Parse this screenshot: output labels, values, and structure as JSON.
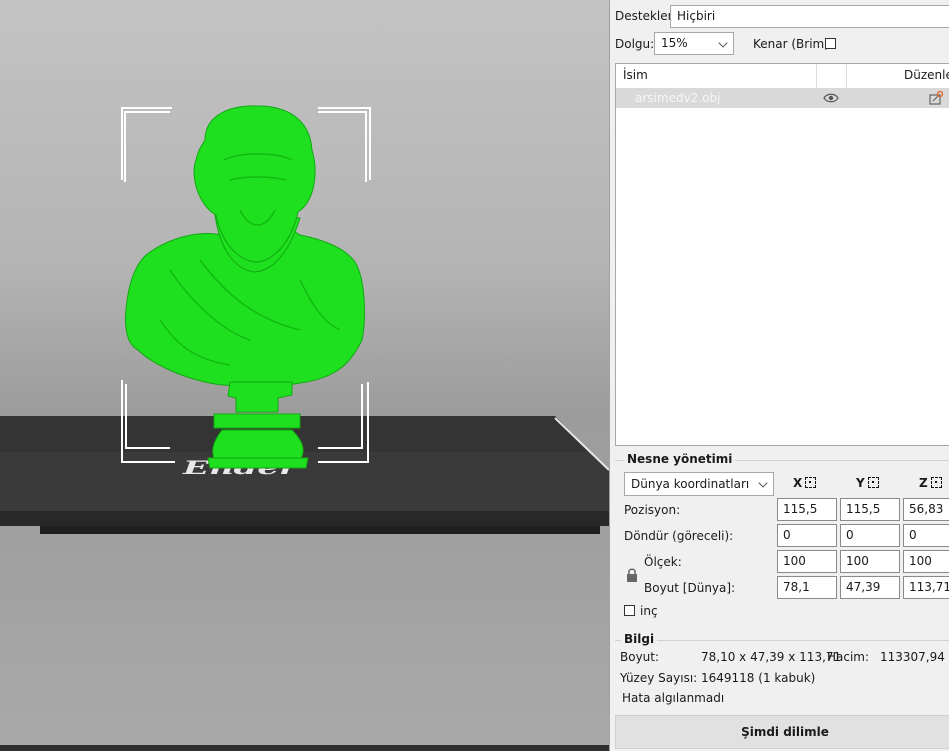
{
  "supports": {
    "label": "Destekler:",
    "value": "Hiçbiri"
  },
  "infill": {
    "label": "Dolgu:",
    "value": "15%"
  },
  "brim": {
    "label": "Kenar (Brim):",
    "checked": false
  },
  "object_list": {
    "columns": [
      "İsim",
      "",
      "Düzenler"
    ],
    "rows": [
      {
        "name": "arsimedv2.obj",
        "visible_icon": "eye-icon",
        "edit_icon": "edit-warning-icon"
      }
    ]
  },
  "object_manipulation": {
    "title": "Nesne yönetimi",
    "coordinate_system": "Dünya koordinatları",
    "axes": [
      "X",
      "Y",
      "Z"
    ],
    "position": {
      "label": "Pozisyon:",
      "values": [
        "115,5",
        "115,5",
        "56,83"
      ]
    },
    "rotate": {
      "label": "Döndür (göreceli):",
      "values": [
        "0",
        "0",
        "0"
      ]
    },
    "scale": {
      "label": "Ölçek:",
      "values": [
        "100",
        "100",
        "100"
      ]
    },
    "size": {
      "label": "Boyut [Dünya]:",
      "values": [
        "78,1",
        "47,39",
        "113,71"
      ]
    },
    "inches": {
      "label": "inç",
      "checked": false
    },
    "lock_icon": "lock-icon"
  },
  "info": {
    "title": "Bilgi",
    "size_label": "Boyut:",
    "size_value": "78,10 x 47,39 x 113,71",
    "volume_label": "Hacim:",
    "volume_value": "113307,94",
    "facets_label": "Yüzey Sayısı:",
    "facets_value": "1649118 (1 kabuk)",
    "errors": "Hata algılanmadı"
  },
  "slice_button": "Şimdi dilimle",
  "viewport": {
    "bed_logo": "Ender",
    "model_color": "#1ee01e"
  }
}
